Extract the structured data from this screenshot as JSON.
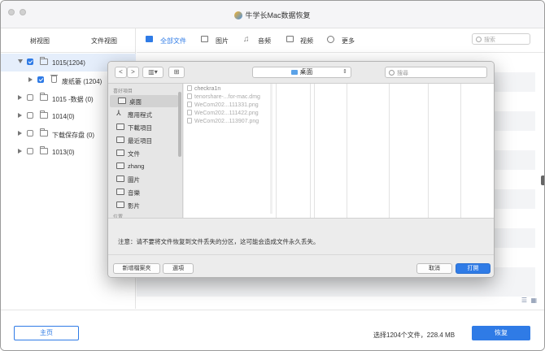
{
  "app": {
    "title": "牛学长Mac数据恢复"
  },
  "sidebar": {
    "tabs": [
      "树视图",
      "文件视图"
    ],
    "items": [
      {
        "label": "1015(1204)",
        "expanded": true,
        "checked": true,
        "selected": true
      },
      {
        "label": "废纸篓 (1204)",
        "checked": true,
        "child": true
      },
      {
        "label": "1015 -数据 (0)",
        "checked": false
      },
      {
        "label": "1014(0)",
        "checked": false
      },
      {
        "label": "下载保存盘 (0)",
        "checked": false
      },
      {
        "label": "1013(0)",
        "checked": false
      }
    ]
  },
  "filters": {
    "items": [
      "全部文件",
      "图片",
      "音频",
      "视频",
      "更多"
    ],
    "active": "全部文件",
    "search_placeholder": "搜索"
  },
  "footer": {
    "home_label": "主页",
    "status": "选择1204个文件，228.4 MB",
    "recover_label": "恢复"
  },
  "dialog": {
    "path": "桌面",
    "search_placeholder": "搜尋",
    "sidebar_heading": "喜好項目",
    "sidebar_items": [
      {
        "label": "桌面",
        "icon": "desktop-icon",
        "selected": true
      },
      {
        "label": "應用程式",
        "icon": "applications-icon"
      },
      {
        "label": "下載項目",
        "icon": "downloads-icon"
      },
      {
        "label": "最近項目",
        "icon": "recents-icon"
      },
      {
        "label": "文件",
        "icon": "documents-icon"
      },
      {
        "label": "zhang",
        "icon": "home-icon"
      },
      {
        "label": "圖片",
        "icon": "pictures-icon"
      },
      {
        "label": "音樂",
        "icon": "music-icon"
      },
      {
        "label": "影片",
        "icon": "movies-icon"
      }
    ],
    "sidebar_locations": "位置",
    "files": [
      "checkra1n",
      "tenorshare-...for-mac.dmg",
      "WeCom202...111331.png",
      "WeCom202...111422.png",
      "WeCom202...113907.png"
    ],
    "notice": "注意：请不要将文件恢复到文件丢失的分区，这可能会造成文件永久丢失。",
    "buttons": {
      "new_folder": "新增檔案夾",
      "options": "選項",
      "cancel": "取消",
      "open": "打開"
    }
  },
  "colors": {
    "accent": "#2f7be6"
  }
}
